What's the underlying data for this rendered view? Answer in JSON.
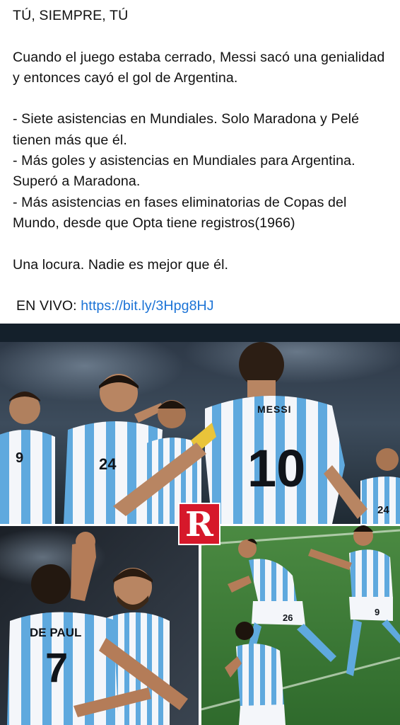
{
  "post": {
    "headline": "TÚ, SIEMPRE, TÚ",
    "intro": "Cuando el juego estaba cerrado, Messi sacó una genialidad y entonces cayó el gol de Argentina.",
    "bullets": [
      "- Siete asistencias en Mundiales. Solo Maradona y Pelé tienen más que él.",
      "- Más goles y asistencias en Mundiales para Argentina. Superó a Maradona.",
      "- Más asistencias en fases eliminatorias de Copas del Mundo, desde que Opta tiene registros(1966)"
    ],
    "closing": "Una locura. Nadie es mejor que él.",
    "live_label": "EN VIVO:",
    "live_link": "https://bit.ly/3Hpg8HJ"
  },
  "photos": {
    "logo_letter": "R",
    "shirt_name_main": "MESSI",
    "shirt_number_main": "10",
    "shirt_number_left": "9",
    "shirt_number_mid": "24",
    "shirt_number_right": "24",
    "shirt_name_bl": "DE PAUL",
    "shirt_number_bl": "7",
    "shirt_number_br_a": "26",
    "shirt_number_br_b": "9",
    "colors": {
      "sky_blue": "#5fa9de",
      "shirt_white": "#f4f6fa",
      "pitch_green": "#3f7b3a",
      "logo_red": "#d6182a"
    }
  }
}
